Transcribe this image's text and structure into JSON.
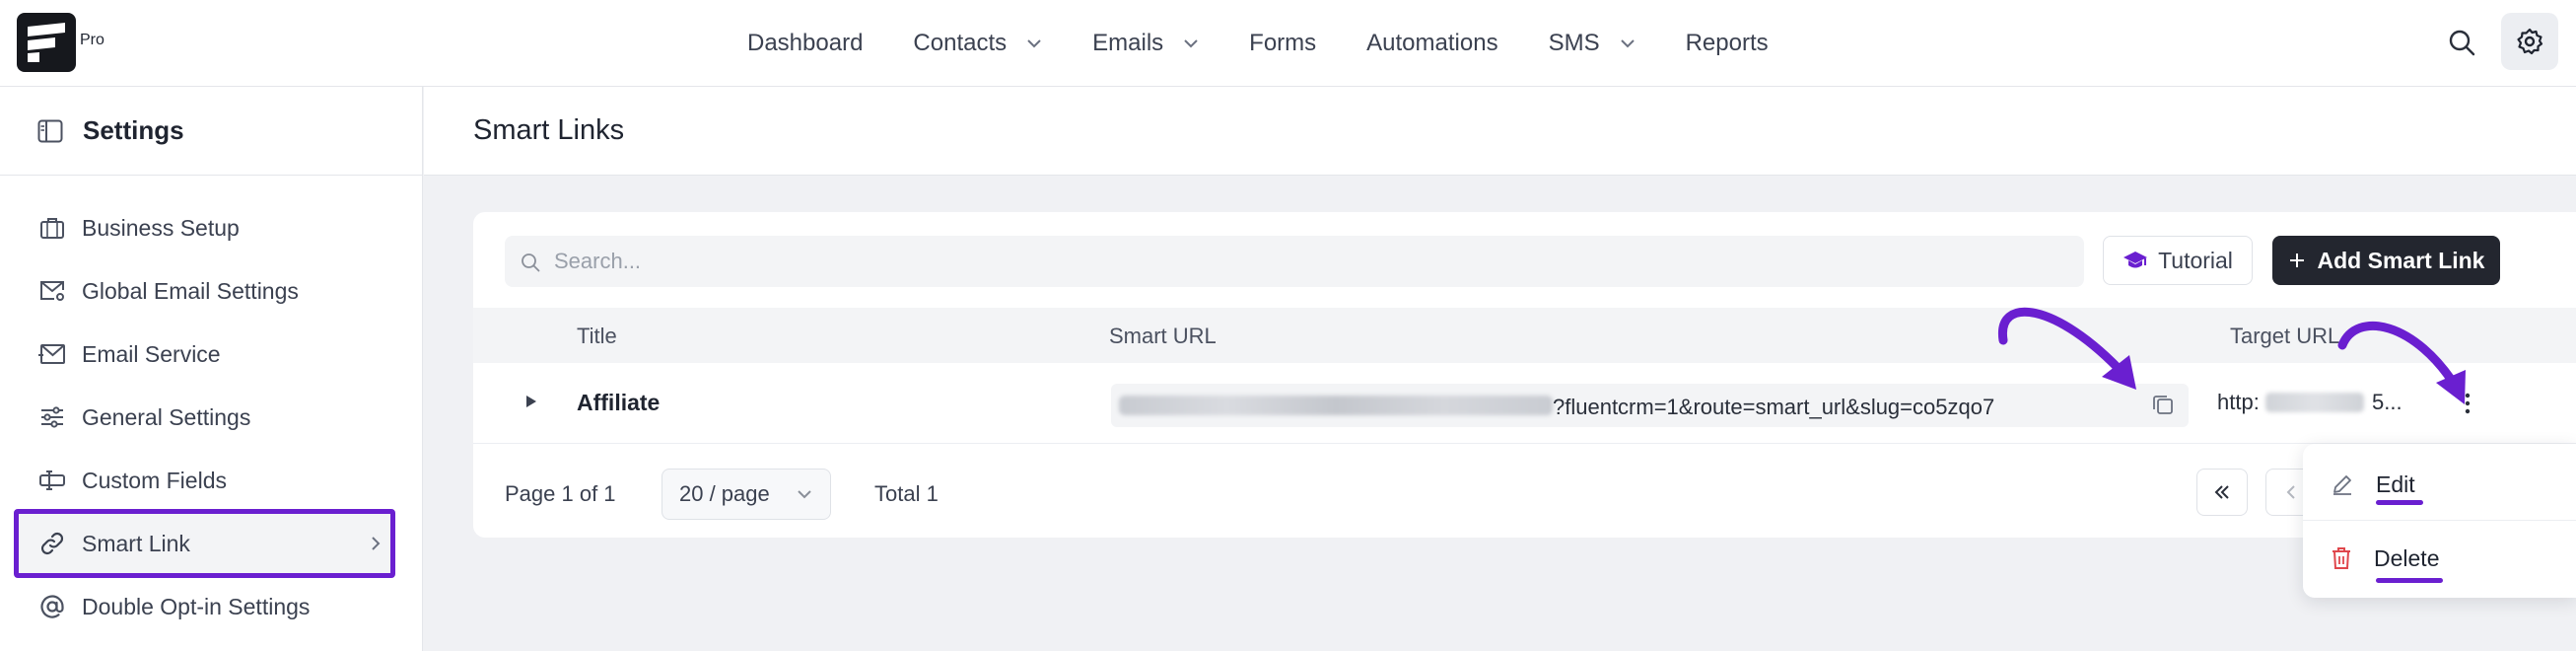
{
  "brand": {
    "badge": "Pro"
  },
  "nav": {
    "items": [
      {
        "label": "Dashboard",
        "dropdown": false
      },
      {
        "label": "Contacts",
        "dropdown": true
      },
      {
        "label": "Emails",
        "dropdown": true
      },
      {
        "label": "Forms",
        "dropdown": false
      },
      {
        "label": "Automations",
        "dropdown": false
      },
      {
        "label": "SMS",
        "dropdown": true
      },
      {
        "label": "Reports",
        "dropdown": false
      }
    ],
    "search_icon": "search-icon",
    "settings_icon": "gear-icon"
  },
  "sidebar": {
    "title": "Settings",
    "items": [
      {
        "label": "Business Setup",
        "icon": "briefcase-icon"
      },
      {
        "label": "Global Email Settings",
        "icon": "mail-settings-icon"
      },
      {
        "label": "Email Service",
        "icon": "mail-send-icon"
      },
      {
        "label": "General Settings",
        "icon": "sliders-icon"
      },
      {
        "label": "Custom Fields",
        "icon": "custom-fields-icon"
      },
      {
        "label": "Smart Link",
        "icon": "link-icon",
        "active": true
      },
      {
        "label": "Double Opt-in Settings",
        "icon": "at-icon"
      }
    ]
  },
  "page": {
    "title": "Smart Links"
  },
  "toolbar": {
    "search_placeholder": "Search...",
    "tutorial_label": "Tutorial",
    "add_label": "Add Smart Link"
  },
  "table": {
    "headers": {
      "title": "Title",
      "smart_url": "Smart URL",
      "target_url": "Target URL"
    },
    "rows": [
      {
        "title": "Affiliate",
        "smart_url_visible": "?fluentcrm=1&route=smart_url&slug=co5zqo7",
        "target_url_start": "http:",
        "target_url_end": "5..."
      }
    ]
  },
  "pagination": {
    "page_info": "Page 1 of 1",
    "per_page": "20 / page",
    "total": "Total 1"
  },
  "row_menu": {
    "edit_label": "Edit",
    "delete_label": "Delete"
  },
  "colors": {
    "accent_purple": "#6a1fd0",
    "primary_button": "#23262f",
    "danger": "#e0474c"
  }
}
